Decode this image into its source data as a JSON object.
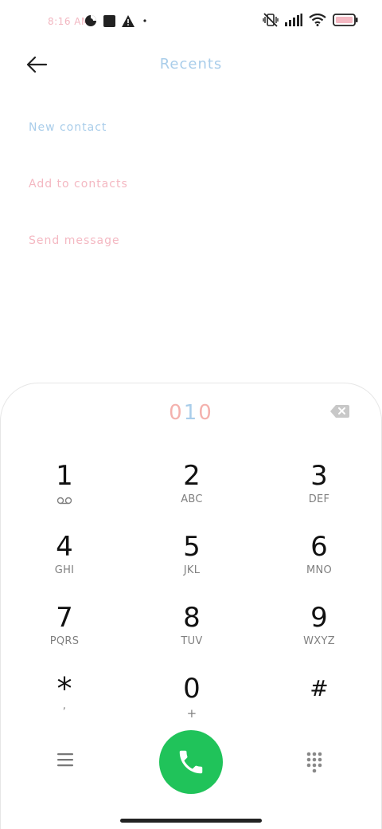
{
  "status_bar": {
    "time": "8:16 AM",
    "left_icons": [
      "data-saver-icon",
      "square-notification-icon",
      "warning-icon",
      "dot-icon"
    ],
    "right_icons": [
      "vibrate-off-icon",
      "signal-icon",
      "wifi-icon",
      "battery-icon"
    ]
  },
  "header": {
    "title": "Recents",
    "back_icon": "arrow-left-icon"
  },
  "actions": [
    {
      "label": "New contact",
      "color": "#a9cdea"
    },
    {
      "label": "Add to contacts",
      "color": "#f4b8c2"
    },
    {
      "label": "Send message",
      "color": "#f4b8c2"
    }
  ],
  "dialer": {
    "number": "010",
    "number_colors": [
      "#f4b1ad",
      "#a9cdea",
      "#f4b1ad"
    ],
    "backspace_icon": "backspace-icon",
    "keys": [
      {
        "digit": "1",
        "letters": "",
        "sub_icon": "voicemail-icon"
      },
      {
        "digit": "2",
        "letters": "ABC"
      },
      {
        "digit": "3",
        "letters": "DEF"
      },
      {
        "digit": "4",
        "letters": "GHI"
      },
      {
        "digit": "5",
        "letters": "JKL"
      },
      {
        "digit": "6",
        "letters": "MNO"
      },
      {
        "digit": "7",
        "letters": "PQRS"
      },
      {
        "digit": "8",
        "letters": "TUV"
      },
      {
        "digit": "9",
        "letters": "WXYZ"
      },
      {
        "digit": "*",
        "letters": ","
      },
      {
        "digit": "0",
        "letters": "+"
      },
      {
        "digit": "#",
        "letters": ""
      }
    ]
  },
  "bottom_bar": {
    "menu_icon": "menu-icon",
    "call_icon": "phone-icon",
    "call_color": "#20c35a",
    "keypad_icon": "dialpad-icon"
  }
}
